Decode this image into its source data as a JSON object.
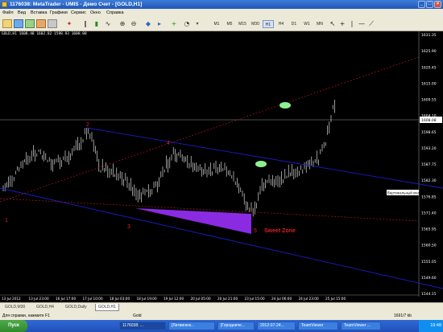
{
  "window": {
    "title": "1176038: MetaTrader - UMIS - Демо Счет - [GOLD,H1]",
    "buttons": [
      "_",
      "□",
      "×"
    ]
  },
  "menu": {
    "items": [
      "Файл",
      "Вид",
      "Вставка",
      "Графики",
      "Сервис",
      "Окно",
      "Справка"
    ]
  },
  "toolbar": {
    "timeframes": [
      "M1",
      "M5",
      "M15",
      "M30",
      "H1",
      "H4",
      "D1",
      "W1",
      "MN"
    ],
    "active_timeframe": "H1"
  },
  "chart": {
    "header": "GOLD,H1  1608.48  1602.82  1598.93  1608.08",
    "price_label": "1608.08",
    "price_axis": [
      "1631.35",
      "1625.90",
      "1620.45",
      "1615.00",
      "1609.55",
      "1604.10",
      "1598.65",
      "1593.20",
      "1587.75",
      "1582.30",
      "1576.85",
      "1571.40",
      "1565.95",
      "1560.50",
      "1555.05",
      "1549.60",
      "1544.15"
    ],
    "time_axis": [
      "13 Jul 2012",
      "13 Jul 23:00",
      "16 Jul 17:00",
      "17 Jul 10:00",
      "18 Jul 03:00",
      "18 Jul 19:00",
      "19 Jul 12:00",
      "20 Jul 05:00",
      "20 Jul 21:00",
      "23 Jul 15:00",
      "24 Jul 06:00",
      "24 Jul 23:00",
      "25 Jul 15:00"
    ],
    "annotations": {
      "p1": "1",
      "p2": "2",
      "p3": "3",
      "p4": "4",
      "p5": "5",
      "zone": "Sweet Zone",
      "hline_label": "Вертикальный масштаб"
    },
    "colors": {
      "bg": "#000000",
      "bars": "#ffffff",
      "channel": "#1c1cc8",
      "dotted_trend": "#b01818",
      "labels": "#e02020",
      "zone": "#8a2be2",
      "target": "#8ef08e"
    }
  },
  "tabs": [
    "GOLD,M30",
    "GOLD,H4",
    "GOLD,Daily",
    "GOLD,H1"
  ],
  "active_tab": "GOLD,H1",
  "status": {
    "help": "Для справки, нажмите F1",
    "profile": "Gold",
    "traffic": "1691/7 kb"
  },
  "taskbar": {
    "start": "Пуск",
    "tasks": [
      "1176038: ...",
      "[Литвинюк...",
      "[Городниче...",
      "2012-07-24...",
      "TeamViewer",
      "TeamViewer ..."
    ],
    "clock": "19:48"
  }
}
